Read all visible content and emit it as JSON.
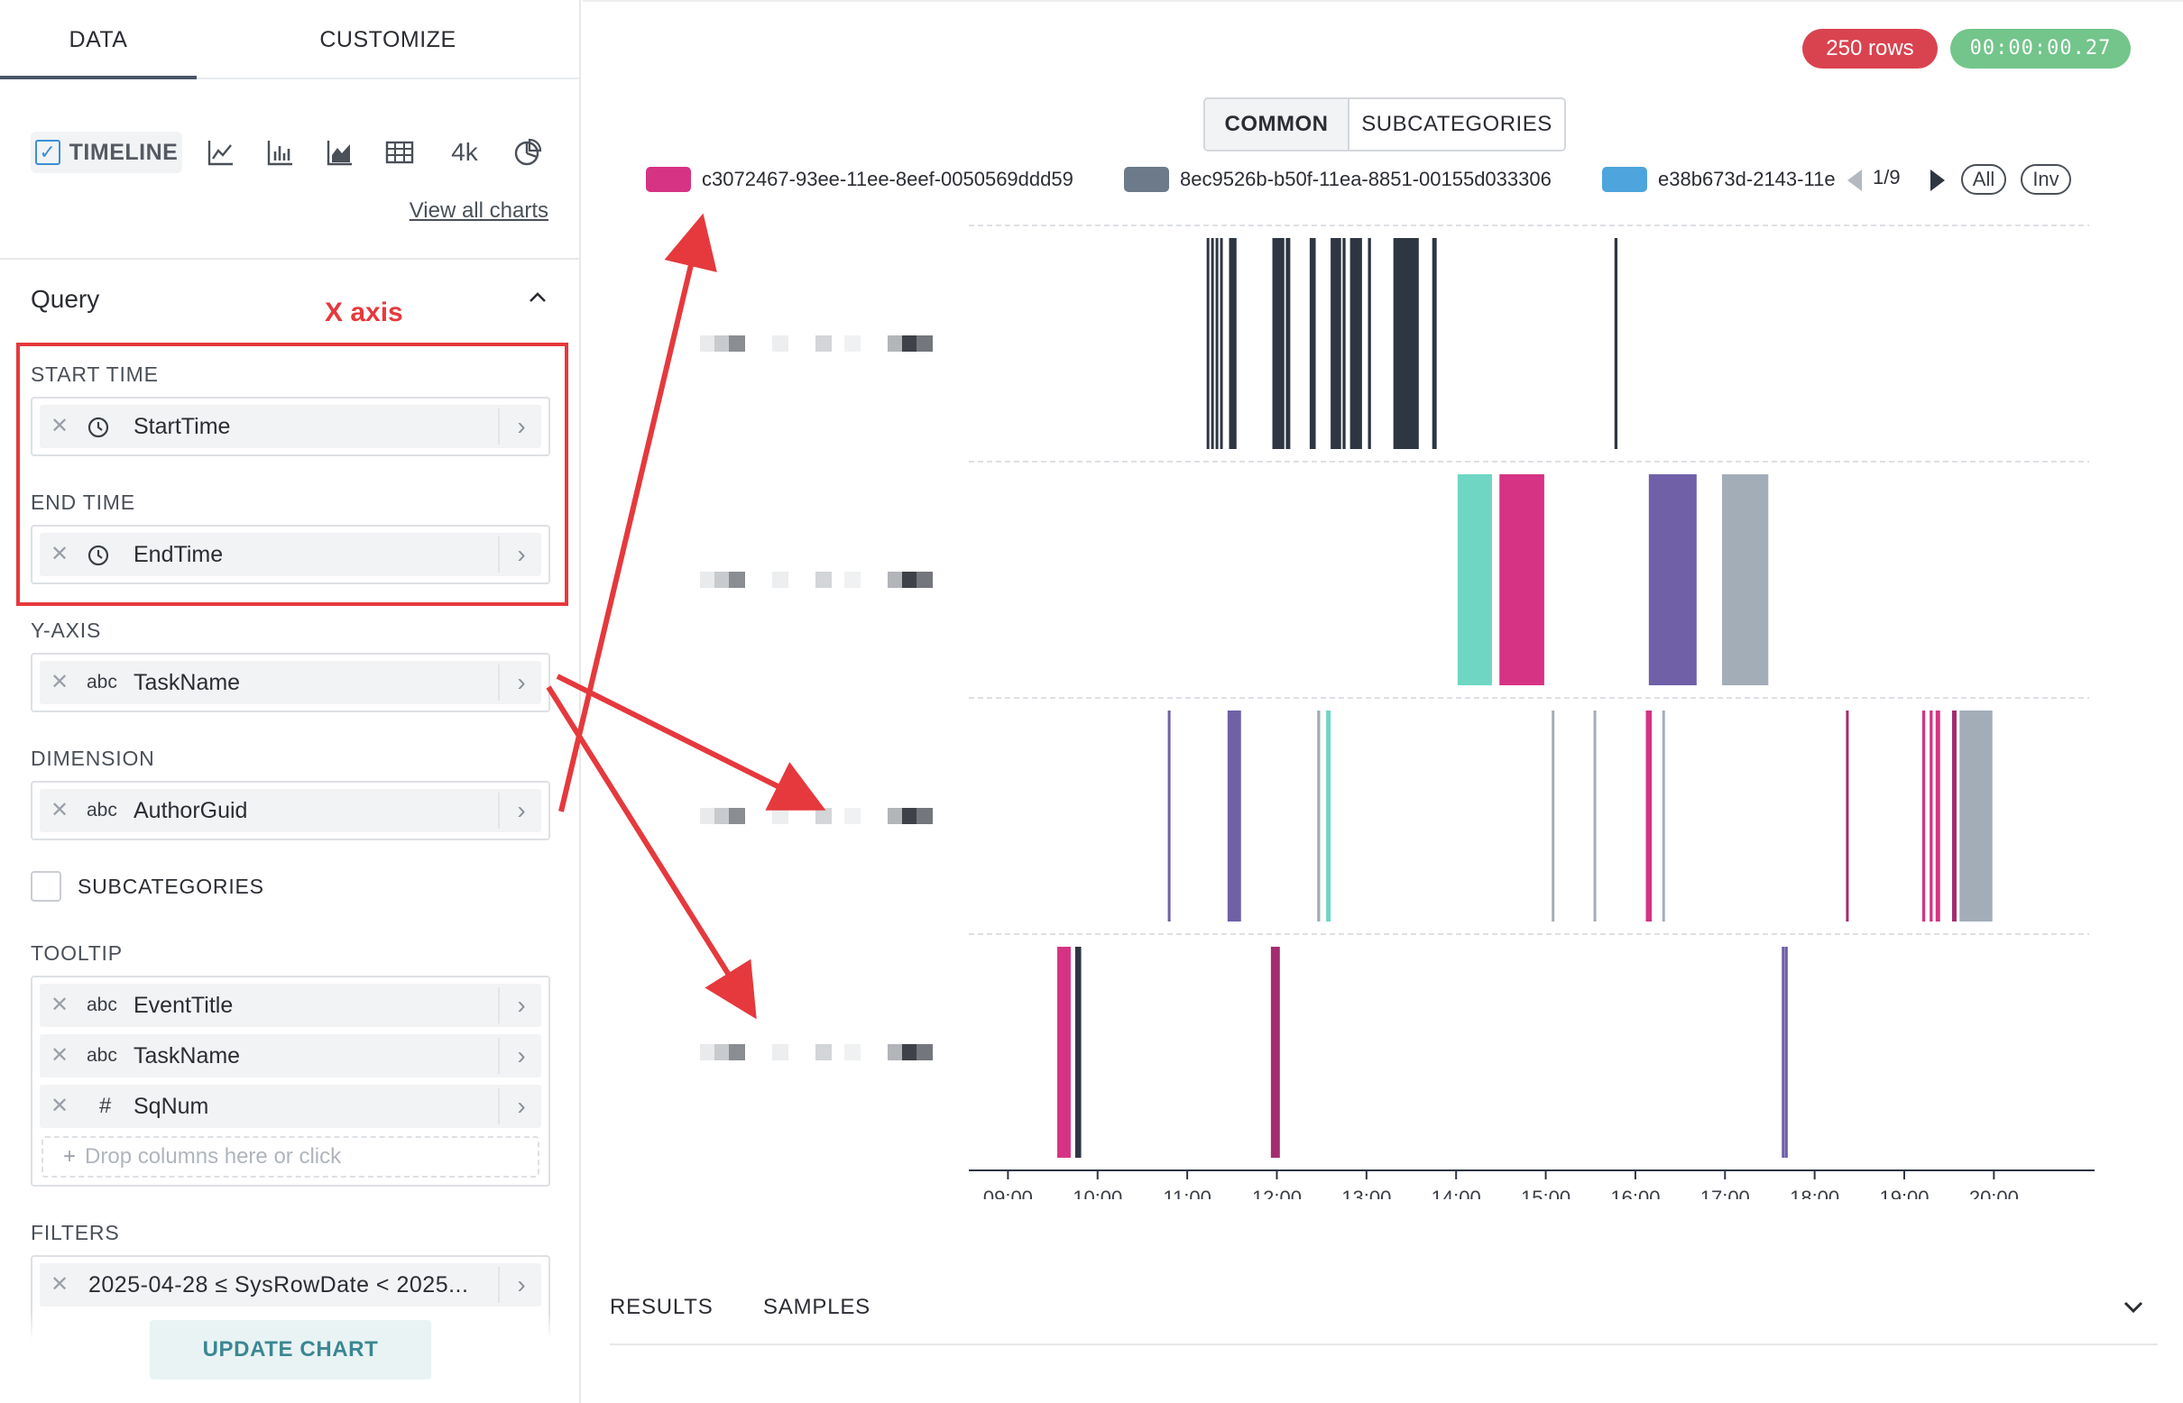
{
  "tabs": {
    "data": "DATA",
    "customize": "CUSTOMIZE"
  },
  "chart_types": {
    "timeline": "TIMELINE",
    "four_k": "4k",
    "view_all": "View all charts"
  },
  "query": {
    "title": "Query",
    "annotation": "X axis",
    "start_time": {
      "label": "START TIME",
      "field": "StartTime"
    },
    "end_time": {
      "label": "END TIME",
      "field": "EndTime"
    },
    "y_axis": {
      "label": "Y-AXIS",
      "type": "abc",
      "field": "TaskName"
    },
    "dimension": {
      "label": "DIMENSION",
      "type": "abc",
      "field": "AuthorGuid"
    },
    "subcategories": "SUBCATEGORIES",
    "tooltip": {
      "label": "TOOLTIP",
      "fields": [
        {
          "type": "abc",
          "name": "EventTitle"
        },
        {
          "type": "abc",
          "name": "TaskName"
        },
        {
          "type": "#",
          "name": "SqNum"
        }
      ],
      "drop_hint": "Drop columns here or click"
    },
    "filters": {
      "label": "FILTERS",
      "filter": "2025-04-28 ≤ SysRowDate < 2025..."
    },
    "update_button": "UPDATE CHART"
  },
  "status": {
    "rows": "250 rows",
    "elapsed": "00:00:00.27"
  },
  "view_mode": {
    "common": "COMMON",
    "subcategories": "SUBCATEGORIES",
    "active": "common"
  },
  "legend": {
    "items": [
      {
        "label": "c3072467-93ee-11ee-8eef-0050569ddd59",
        "color": "#d63384"
      },
      {
        "label": "8ec9526b-b50f-11ea-8851-00155d033306",
        "color": "#6c7a89"
      },
      {
        "label": "e38b673d-2143-11ef-8e",
        "color": "#4ea4dd"
      }
    ],
    "page": "1/9",
    "all": "All",
    "inv": "Inv"
  },
  "colors": {
    "dark": "#2e3642",
    "pink": "#d63384",
    "magenta": "#a52b6f",
    "purple": "#7060a8",
    "gray": "#a3adb8",
    "teal": "#6fd6c4",
    "accent_red": "#e5393d"
  },
  "chart_data": {
    "type": "timeline",
    "x_range": [
      "08:35",
      "21:05"
    ],
    "x_ticks": [
      "09:00",
      "10:00",
      "11:00",
      "12:00",
      "13:00",
      "14:00",
      "15:00",
      "16:00",
      "17:00",
      "18:00",
      "19:00",
      "20:00"
    ],
    "rows": [
      {
        "task": "(redacted)",
        "bars": [
          {
            "start": "11:13",
            "end": "11:14",
            "color": "dark"
          },
          {
            "start": "11:16",
            "end": "11:17",
            "color": "dark"
          },
          {
            "start": "11:19",
            "end": "11:20",
            "color": "dark"
          },
          {
            "start": "11:22",
            "end": "11:23",
            "color": "dark"
          },
          {
            "start": "11:28",
            "end": "11:33",
            "color": "dark"
          },
          {
            "start": "11:57",
            "end": "12:05",
            "color": "dark"
          },
          {
            "start": "12:06",
            "end": "12:09",
            "color": "dark"
          },
          {
            "start": "12:22",
            "end": "12:26",
            "color": "dark"
          },
          {
            "start": "12:36",
            "end": "12:43",
            "color": "dark"
          },
          {
            "start": "12:44",
            "end": "12:46",
            "color": "dark"
          },
          {
            "start": "12:49",
            "end": "12:57",
            "color": "dark"
          },
          {
            "start": "13:01",
            "end": "13:03",
            "color": "dark"
          },
          {
            "start": "13:18",
            "end": "13:35",
            "color": "dark"
          },
          {
            "start": "13:44",
            "end": "13:47",
            "color": "dark"
          },
          {
            "start": "15:46",
            "end": "15:48",
            "color": "dark"
          }
        ]
      },
      {
        "task": "(redacted)",
        "bars": [
          {
            "start": "14:01",
            "end": "14:24",
            "color": "teal"
          },
          {
            "start": "14:29",
            "end": "14:59",
            "color": "pink"
          },
          {
            "start": "16:09",
            "end": "16:41",
            "color": "purple"
          },
          {
            "start": "16:58",
            "end": "17:29",
            "color": "gray"
          }
        ]
      },
      {
        "task": "(redacted)",
        "bars": [
          {
            "start": "10:47",
            "end": "10:48",
            "color": "purple"
          },
          {
            "start": "11:27",
            "end": "11:36",
            "color": "purple"
          },
          {
            "start": "12:27",
            "end": "12:29",
            "color": "gray"
          },
          {
            "start": "12:33",
            "end": "12:36",
            "color": "teal"
          },
          {
            "start": "15:04",
            "end": "15:05",
            "color": "gray"
          },
          {
            "start": "15:32",
            "end": "15:33",
            "color": "gray"
          },
          {
            "start": "16:07",
            "end": "16:11",
            "color": "pink"
          },
          {
            "start": "16:18",
            "end": "16:19",
            "color": "gray"
          },
          {
            "start": "18:21",
            "end": "18:22",
            "color": "magenta"
          },
          {
            "start": "19:12",
            "end": "19:14",
            "color": "pink"
          },
          {
            "start": "19:17",
            "end": "19:19",
            "color": "pink"
          },
          {
            "start": "19:21",
            "end": "19:24",
            "color": "pink"
          },
          {
            "start": "19:32",
            "end": "19:35",
            "color": "magenta"
          },
          {
            "start": "19:37",
            "end": "19:59",
            "color": "gray"
          }
        ]
      },
      {
        "task": "(redacted)",
        "bars": [
          {
            "start": "09:33",
            "end": "09:42",
            "color": "pink"
          },
          {
            "start": "09:45",
            "end": "09:49",
            "color": "dark"
          },
          {
            "start": "11:56",
            "end": "12:02",
            "color": "magenta"
          },
          {
            "start": "17:38",
            "end": "17:39",
            "color": "purple"
          },
          {
            "start": "17:40",
            "end": "17:42",
            "color": "purple"
          }
        ]
      }
    ]
  },
  "results_tabs": {
    "results": "RESULTS",
    "samples": "SAMPLES"
  }
}
